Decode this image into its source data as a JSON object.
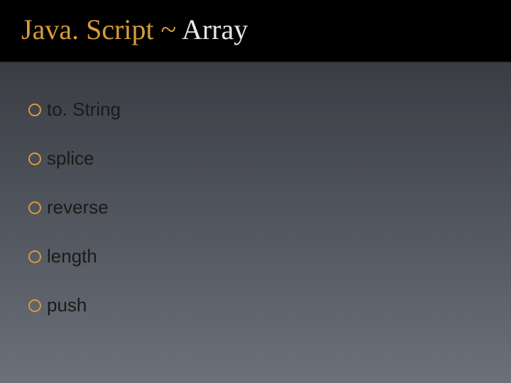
{
  "title": {
    "part1": "Java. Script ~ ",
    "part2": "Array"
  },
  "items": [
    {
      "label": "to. String"
    },
    {
      "label": "splice"
    },
    {
      "label": "reverse"
    },
    {
      "label": "length"
    },
    {
      "label": "push"
    }
  ]
}
